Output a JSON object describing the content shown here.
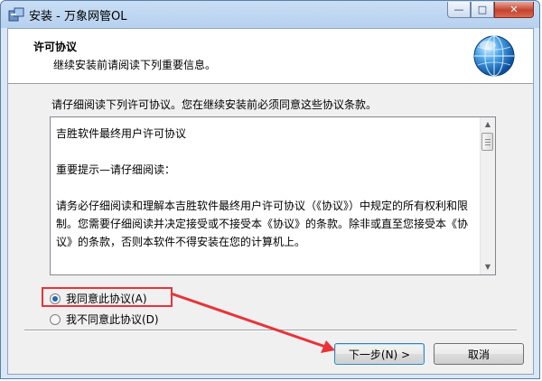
{
  "window": {
    "title": "安装 - 万象网管OL",
    "controls": {
      "minimize": "—",
      "maximize": "□",
      "close": "✕"
    }
  },
  "header": {
    "title": "许可协议",
    "subtitle": "继续安装前请阅读下列重要信息。",
    "icon": "globe-icon"
  },
  "intro": "请仔细阅读下列许可协议。您在继续安装前必须同意这些协议条款。",
  "license": {
    "lines": [
      "吉胜软件最终用户许可协议",
      "重要提示—请仔细阅读：",
      "请务必仔细阅读和理解本吉胜软件最终用户许可协议（《协议》）中规定的所有权利和限制。您需要仔细阅读并决定接受或不接受本《协议》的条款。除非或直至您接受本《协议》的条款，否则本软件不得安装在您的计算机上。"
    ]
  },
  "options": [
    {
      "label": "我同意此协议(A)",
      "selected": true
    },
    {
      "label": "我不同意此协议(D)",
      "selected": false
    }
  ],
  "buttons": {
    "next": "下一步(N) >",
    "cancel": "取消"
  },
  "colors": {
    "highlight": "#e8333a",
    "radio_selected": "#2563b5"
  }
}
